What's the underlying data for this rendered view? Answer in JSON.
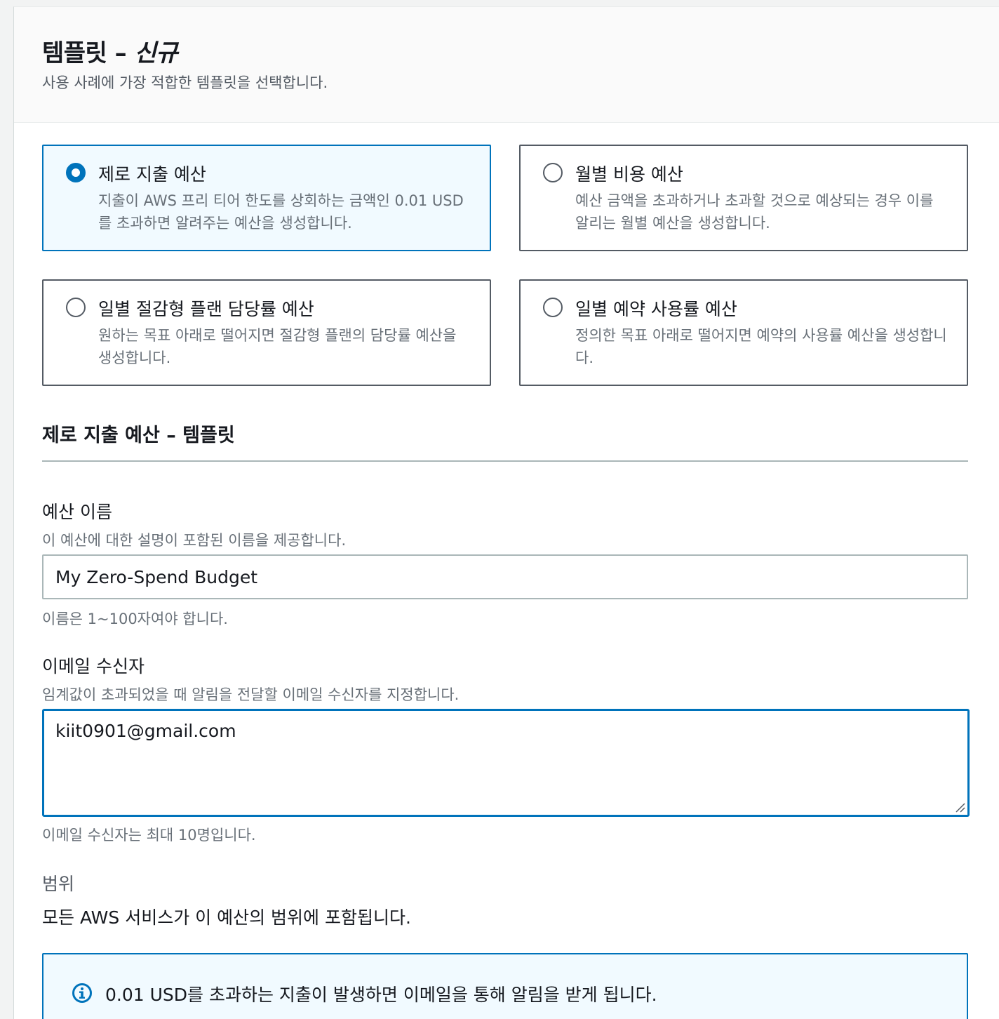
{
  "header": {
    "title_main": "템플릿 – ",
    "title_italic": "신규",
    "description": "사용 사례에 가장 적합한 템플릿을 선택합니다."
  },
  "templates": [
    {
      "title": "제로 지출 예산",
      "description": "지출이 AWS 프리 티어 한도를 상회하는 금액인 0.01 USD를 초과하면 알려주는 예산을 생성합니다.",
      "selected": true
    },
    {
      "title": "월별 비용 예산",
      "description": "예산 금액을 초과하거나 초과할 것으로 예상되는 경우 이를 알리는 월별 예산을 생성합니다.",
      "selected": false
    },
    {
      "title": "일별 절감형 플랜 담당률 예산",
      "description": "원하는 목표 아래로 떨어지면 절감형 플랜의 담당률 예산을 생성합니다.",
      "selected": false
    },
    {
      "title": "일별 예약 사용률 예산",
      "description": "정의한 목표 아래로 떨어지면 예약의 사용률 예산을 생성합니다.",
      "selected": false
    }
  ],
  "section": {
    "title": "제로 지출 예산 – 템플릿"
  },
  "budget_name": {
    "label": "예산 이름",
    "description": "이 예산에 대한 설명이 포함된 이름을 제공합니다.",
    "value": "My Zero-Spend Budget",
    "constraint": "이름은 1~100자여야 합니다."
  },
  "email_recipients": {
    "label": "이메일 수신자",
    "description": "임계값이 초과되었을 때 알림을 전달할 이메일 수신자를 지정합니다.",
    "value": "kiit0901@gmail.com",
    "constraint": "이메일 수신자는 최대 10명입니다."
  },
  "scope": {
    "label": "범위",
    "text": "모든 AWS 서비스가 이 예산의 범위에 포함됩니다."
  },
  "info": {
    "text": "0.01 USD를 초과하는 지출이 발생하면 이메일을 통해 알림을 받게 됩니다."
  },
  "colors": {
    "accent": "#0073bb",
    "selected_bg": "#f1faff",
    "border": "#545b64",
    "muted_text": "#687078"
  }
}
